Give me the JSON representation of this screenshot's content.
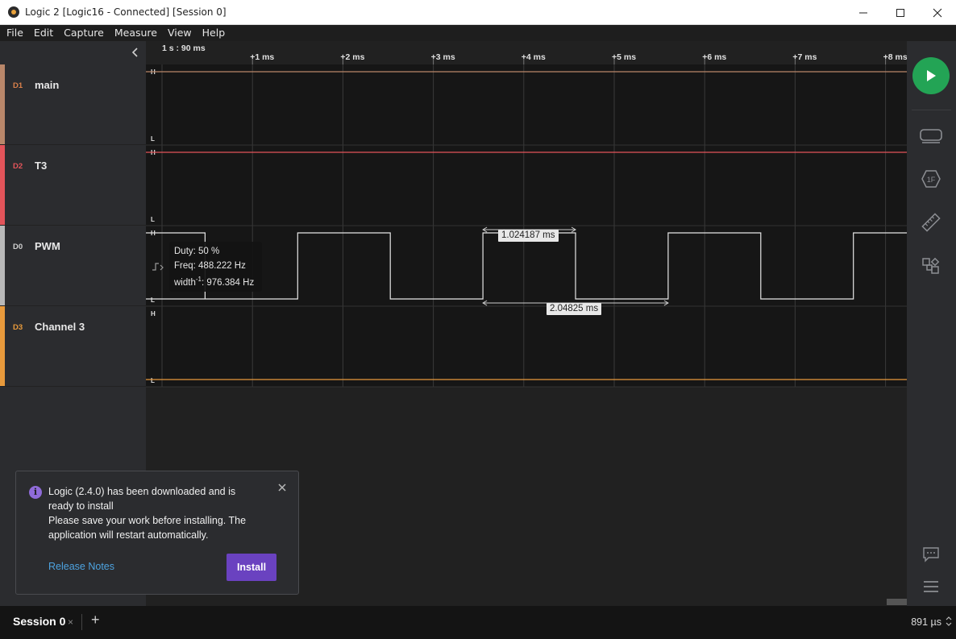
{
  "window": {
    "title": "Logic 2 [Logic16 - Connected] [Session 0]"
  },
  "menu": [
    "File",
    "Edit",
    "Capture",
    "Measure",
    "View",
    "Help"
  ],
  "timeline": {
    "origin_label": "1 s : 90 ms",
    "ticks": [
      "+1 ms",
      "+2 ms",
      "+3 ms",
      "+4 ms",
      "+5 ms",
      "+6 ms",
      "+7 ms",
      "+8 ms"
    ]
  },
  "channels": [
    {
      "id": "D1",
      "name": "main",
      "color": "#b9876a",
      "id_color": "#d9804a",
      "level": "high"
    },
    {
      "id": "D2",
      "name": "T3",
      "color": "#e3545a",
      "id_color": "#e3545a",
      "level": "high"
    },
    {
      "id": "D0",
      "name": "PWM",
      "color": "#b8b8b8",
      "id_color": "#cfcfcf",
      "level": "pwm"
    },
    {
      "id": "D3",
      "name": "Channel 3",
      "color": "#e89a3c",
      "id_color": "#e89a3c",
      "level": "low"
    }
  ],
  "level_labels": {
    "high": "H",
    "low": "L"
  },
  "pwm_tooltip": {
    "duty": "Duty: 50 %",
    "freq": "Freq: 488.222 Hz",
    "width_prefix": "width",
    "width_exp": "-1",
    "width_value": ": 976.384 Hz"
  },
  "measurements": {
    "pulse_width": "1.024187 ms",
    "period": "2.04825 ms"
  },
  "notification": {
    "line1": "Logic (2.4.0) has been downloaded and is",
    "line2": "ready to install",
    "line3": "Please save your work before installing. The",
    "line4": "application will restart automatically.",
    "link": "Release Notes",
    "button": "Install"
  },
  "bottom": {
    "session_tab": "Session 0",
    "close": "×",
    "add": "+",
    "zoom": "891 µs"
  },
  "colors": {
    "run_button": "#23a455",
    "install_button": "#6a42c0",
    "accent_link": "#4da3e0"
  },
  "icons": [
    "app-icon",
    "minimize-icon",
    "maximize-icon",
    "close-icon",
    "chevron-left-icon",
    "play-icon",
    "device-icon",
    "analyzer-icon",
    "measure-ruler-icon",
    "extensions-icon",
    "feedback-chat-icon",
    "hamburger-menu-icon",
    "info-icon",
    "edge-trigger-icon"
  ]
}
